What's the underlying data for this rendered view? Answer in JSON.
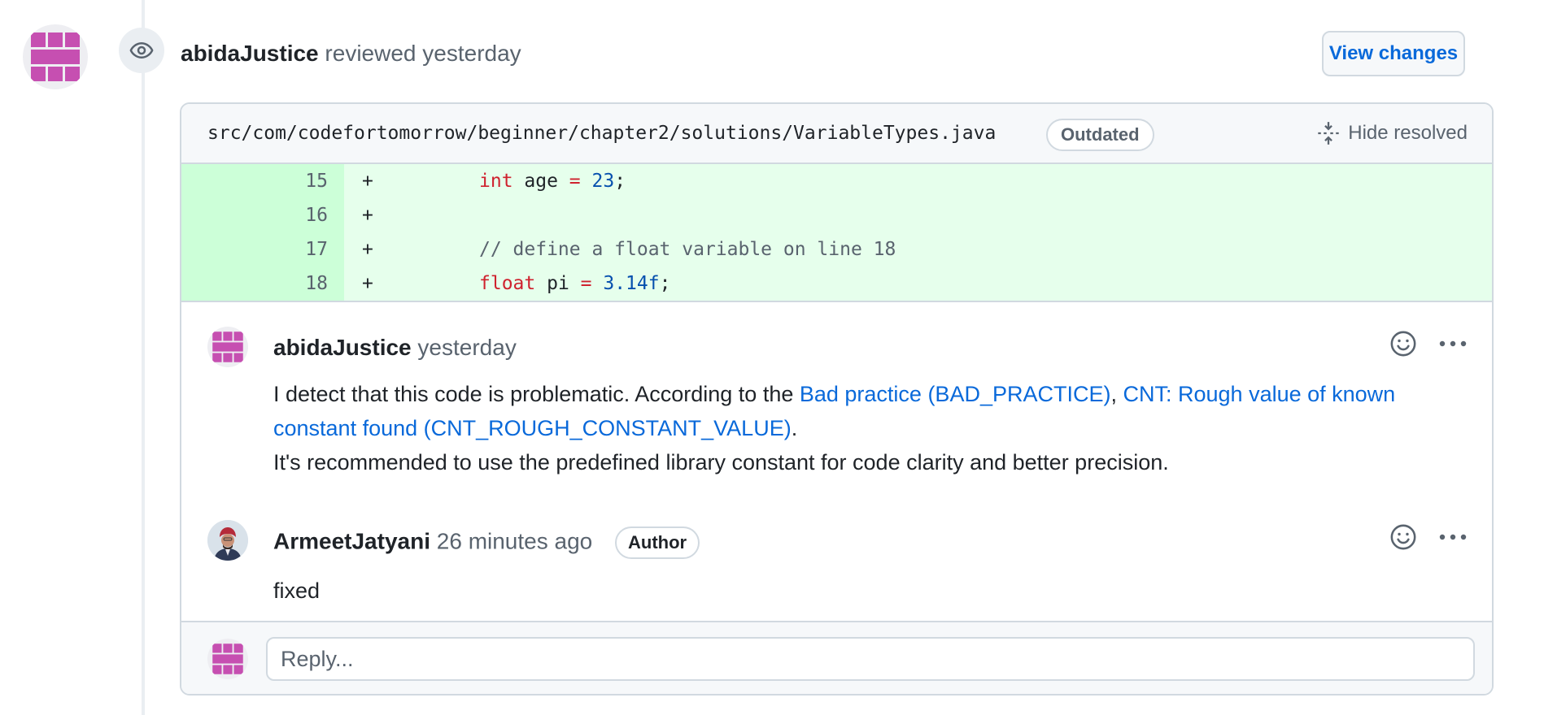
{
  "review": {
    "user": "abidaJustice",
    "action": "reviewed",
    "time": "yesterday",
    "view_changes_label": "View changes"
  },
  "thread": {
    "file_path": "src/com/codefortomorrow/beginner/chapter2/solutions/VariableTypes.java",
    "outdated_label": "Outdated",
    "hide_resolved_label": "Hide resolved",
    "diff_lines": [
      {
        "number": "15",
        "marker": "+",
        "kw": "int",
        "ident": " age ",
        "op": "=",
        "num": " 23",
        "tail": ";",
        "comment": ""
      },
      {
        "number": "16",
        "marker": "+",
        "kw": "",
        "ident": "",
        "op": "",
        "num": "",
        "tail": "",
        "comment": ""
      },
      {
        "number": "17",
        "marker": "+",
        "kw": "",
        "ident": "",
        "op": "",
        "num": "",
        "tail": "",
        "comment": "// define a float variable on line 18"
      },
      {
        "number": "18",
        "marker": "+",
        "kw": "float",
        "ident": " pi ",
        "op": "=",
        "num": " 3.14f",
        "tail": ";",
        "comment": ""
      }
    ],
    "comments": [
      {
        "user": "abidaJustice",
        "time": "yesterday",
        "body_prefix": "I detect that this code is problematic. According to the ",
        "link1": "Bad practice (BAD_PRACTICE)",
        "separator": ", ",
        "link2": "CNT: Rough value of known constant found (CNT_ROUGH_CONSTANT_VALUE)",
        "body_suffix": ".",
        "body_line2": "It's recommended to use the predefined library constant for code clarity and better precision."
      },
      {
        "user": "ArmeetJatyani",
        "time": "26 minutes ago",
        "badge": "Author",
        "body": "fixed"
      }
    ],
    "reply_placeholder": "Reply..."
  },
  "colors": {
    "accent": "#0969da",
    "identicon": "#c64fb1",
    "diff_add_bg": "#e6ffec",
    "diff_add_gutter": "#ccffd8",
    "keyword": "#cf222e",
    "number": "#0550ae"
  },
  "icons": {
    "review": "eye-icon",
    "hide_resolved": "fold-icon",
    "reaction": "smiley-icon",
    "more": "kebab-horizontal-icon"
  }
}
